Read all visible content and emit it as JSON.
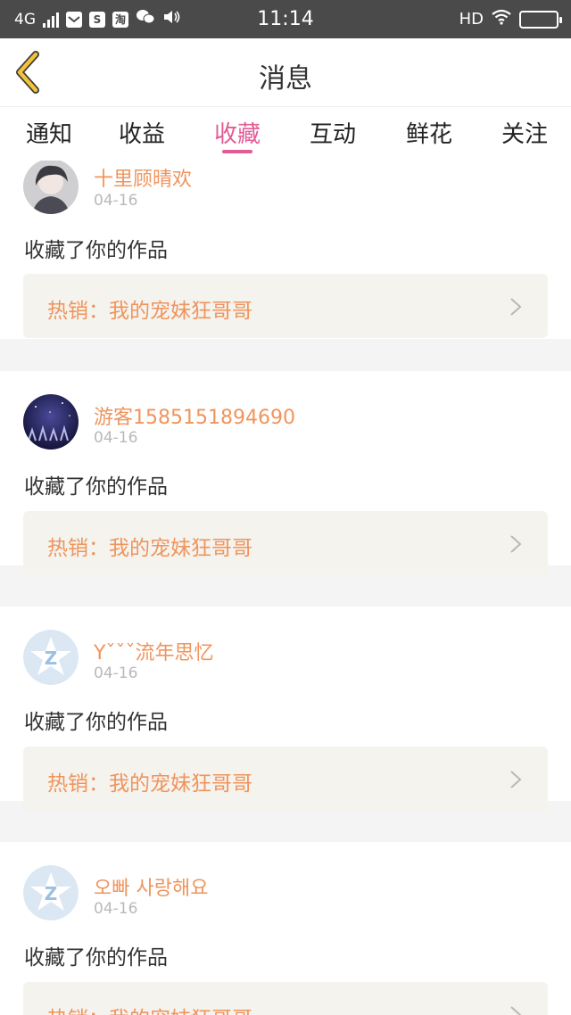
{
  "status_bar": {
    "network": "4G",
    "time": "11:14",
    "hd": "HD",
    "icons": [
      "notification-icon",
      "s-app-icon",
      "taobao-icon",
      "wechat-icon",
      "volume-icon",
      "wifi-icon",
      "battery-icon"
    ],
    "app_glyphs": [
      "S",
      "淘"
    ]
  },
  "header": {
    "title": "消息",
    "back_icon": "back-chevron-icon"
  },
  "tabs": [
    {
      "label": "通知",
      "active": false
    },
    {
      "label": "收益",
      "active": false
    },
    {
      "label": "收藏",
      "active": true
    },
    {
      "label": "互动",
      "active": false
    },
    {
      "label": "鲜花",
      "active": false
    },
    {
      "label": "关注",
      "active": false
    }
  ],
  "messages": [
    {
      "user": "十里顾晴欢",
      "date": "04-16",
      "action": "收藏了你的作品",
      "work": "热销：我的宠妹狂哥哥",
      "avatar": "photo-avatar"
    },
    {
      "user": "游客1585151894690",
      "date": "04-16",
      "action": "收藏了你的作品",
      "work": "热销：我的宠妹狂哥哥",
      "avatar": "night-sky-avatar"
    },
    {
      "user": "Yˇˇˇ流年思忆",
      "date": "04-16",
      "action": "收藏了你的作品",
      "work": "热销：我的宠妹狂哥哥",
      "avatar": "default-avatar",
      "avatar_glyph": "Z"
    },
    {
      "user": "오빠 사랑해요",
      "date": "04-16",
      "action": "收藏了你的作品",
      "work": "热销：我的宠妹狂哥哥",
      "avatar": "default-avatar",
      "avatar_glyph": "Z"
    }
  ],
  "colors": {
    "accent": "#e35b95",
    "username": "#f0945c",
    "back_icon": "#f3c23a",
    "status_bar": "#4a4a4a",
    "card_inner": "#f4f3ee"
  }
}
